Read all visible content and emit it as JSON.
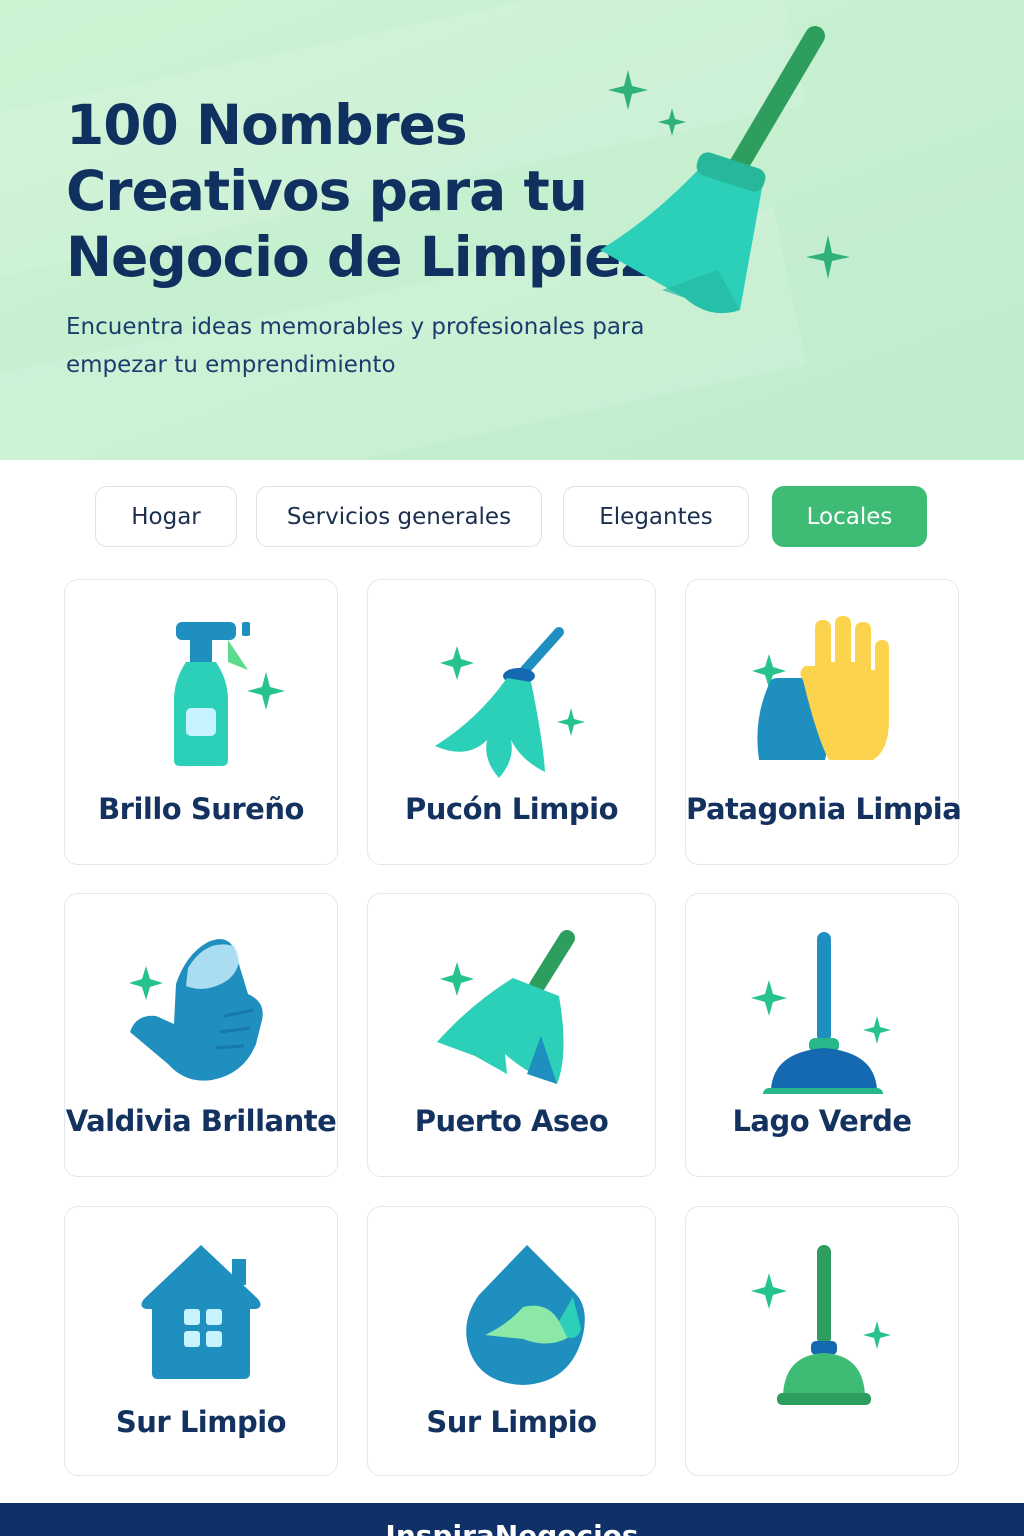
{
  "hero": {
    "title": "100 Nombres Creativos para tu Negocio de Limpieza",
    "subtitle": "Encuentra ideas memorables y profesionales para empezar tu emprendimiento",
    "icon": "broom-icon",
    "background": "#cdf3d3"
  },
  "filters": [
    {
      "label": "Hogar",
      "active": false
    },
    {
      "label": "Servicios generales",
      "active": false
    },
    {
      "label": "Elegantes",
      "active": false
    },
    {
      "label": "Locales",
      "active": true
    }
  ],
  "cards": [
    {
      "label": "Brillo Sureño",
      "icon": "spray-bottle-icon"
    },
    {
      "label": "Pucón Limpio",
      "icon": "mop-icon"
    },
    {
      "label": "Patagonia Limpia",
      "icon": "glove-icon"
    },
    {
      "label": "Valdivia Brillante",
      "icon": "cleaning-glove-icon"
    },
    {
      "label": "Puerto Aseo",
      "icon": "broom-icon"
    },
    {
      "label": "Lago Verde",
      "icon": "plunger-icon"
    },
    {
      "label": "Sur Limpio",
      "icon": "house-icon"
    },
    {
      "label": "Sur Limpio",
      "icon": "water-drop-icon"
    },
    {
      "label": "",
      "icon": "plunger-icon"
    }
  ],
  "footer": {
    "brand": "InspiraNegocios"
  },
  "colors": {
    "accent": "#3ebc76",
    "navy": "#10305f",
    "teal": "#2ccfb8",
    "blue": "#1f8fc0",
    "yellow": "#fcd34d"
  }
}
